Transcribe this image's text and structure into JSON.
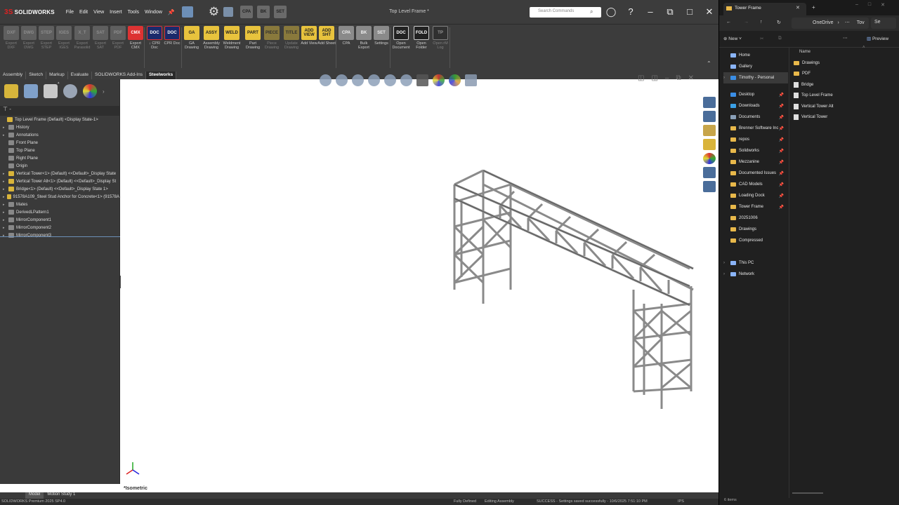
{
  "sw": {
    "app_name": "SOLIDWORKS",
    "menus": [
      "File",
      "Edit",
      "View",
      "Insert",
      "Tools",
      "Window"
    ],
    "doc_title": "Top Level Frame *",
    "search_placeholder": "Search Commands",
    "toolbar_tiles": [
      "CPA",
      "BK",
      "SET"
    ],
    "ribbon": [
      {
        "icon": "DXF",
        "label": "Export DXF",
        "style": "grayi dis"
      },
      {
        "icon": "DWG",
        "label": "Export DWG",
        "style": "grayi dis"
      },
      {
        "icon": "STEP",
        "label": "Export STEP",
        "style": "grayi dis"
      },
      {
        "icon": "IGES",
        "label": "Export IGES",
        "style": "grayi dis"
      },
      {
        "icon": "X_T",
        "label": "Export Parasolid",
        "style": "grayi dis"
      },
      {
        "icon": "SAT",
        "label": "Export SAT",
        "style": "grayi dis"
      },
      {
        "icon": "PDF",
        "label": "Export PDF",
        "style": "grayi dis"
      },
      {
        "icon": "CMX",
        "label": "Export CMX",
        "style": "red"
      },
      {
        "icon": "DOC",
        "label": "↓ CPR Doc",
        "style": "navy"
      },
      {
        "icon": "DOC",
        "label": "CPR Doc",
        "style": "navy"
      },
      {
        "icon": "GA",
        "label": "GA Drawing",
        "style": "yel"
      },
      {
        "icon": "ASSY",
        "label": "Assembly Drawing",
        "style": "yel"
      },
      {
        "icon": "WELD",
        "label": "Weldment Drawing",
        "style": "yel"
      },
      {
        "icon": "PART",
        "label": "Part Drawing",
        "style": "yel"
      },
      {
        "icon": "PIECE",
        "label": "Piece Drawing",
        "style": "yel dis"
      },
      {
        "icon": "TITLE",
        "label": "Update Drawing",
        "style": "yel dis"
      },
      {
        "icon": "ADD VIEW",
        "label": "Add View",
        "style": "yel"
      },
      {
        "icon": "ADD SHT",
        "label": "Add Sheet",
        "style": "yel"
      },
      {
        "icon": "CPA",
        "label": "CPA",
        "style": "grayi"
      },
      {
        "icon": "BK",
        "label": "Bulk Export",
        "style": "grayi"
      },
      {
        "icon": "SET",
        "label": "Settings",
        "style": "grayi"
      },
      {
        "icon": "DOC",
        "label": "Open Document",
        "style": "dark"
      },
      {
        "icon": "FOLD",
        "label": "Open Folder",
        "style": "dark"
      },
      {
        "icon": "TP",
        "label": "Open rM Log",
        "style": "dark dis"
      }
    ],
    "tabs": [
      "Assembly",
      "Sketch",
      "Markup",
      "Evaluate",
      "SOLIDWORKS Add-Ins",
      "Steelworks"
    ],
    "active_tab": "Steelworks",
    "tree": [
      {
        "label": "Top Level Frame (Default) <Display State-1>",
        "expand": "",
        "icon": "yi"
      },
      {
        "label": "History",
        "expand": "▸",
        "icon": ""
      },
      {
        "label": "Annotations",
        "expand": "▸",
        "icon": ""
      },
      {
        "label": "Front Plane",
        "expand": "",
        "icon": ""
      },
      {
        "label": "Top Plane",
        "expand": "",
        "icon": ""
      },
      {
        "label": "Right Plane",
        "expand": "",
        "icon": ""
      },
      {
        "label": "Origin",
        "expand": "",
        "icon": ""
      },
      {
        "label": "Vertical Tower<1> (Default) <<Default>_Display State",
        "expand": "▸",
        "icon": "yi"
      },
      {
        "label": "Vertical Tower Alt<1> (Default) <<Default>_Display St",
        "expand": "▸",
        "icon": "yi"
      },
      {
        "label": "Bridge<1> (Default) <<Default>_Display State 1>",
        "expand": "▸",
        "icon": "yi"
      },
      {
        "label": "91578A109_Steel Stud Anchor for Concrete<1> (91578A",
        "expand": "▸",
        "icon": "yi"
      },
      {
        "label": "Mates",
        "expand": "▸",
        "icon": ""
      },
      {
        "label": "DerivedLPattern1",
        "expand": "▸",
        "icon": ""
      },
      {
        "label": "MirrorComponent1",
        "expand": "▸",
        "icon": ""
      },
      {
        "label": "MirrorComponent2",
        "expand": "▸",
        "icon": ""
      },
      {
        "label": "MirrorComponent3",
        "expand": "▸",
        "icon": ""
      }
    ],
    "view_label": "*Isometric",
    "bottom_tabs": [
      "Model",
      "Motion Study 1"
    ],
    "status": {
      "version": "SOLIDWORKS Premium 2025 SP4.0",
      "defined": "Fully Defined",
      "mode": "Editing Assembly",
      "message": "SUCCESS - Settings saved successfully - 10/6/2025 7:51:10 PM",
      "units": "IPS"
    }
  },
  "explorer": {
    "tab_title": "Tower Frame",
    "address": "OneDrive",
    "address_trail": "Tov",
    "search_short": "Se",
    "new_label": "New",
    "preview_label": "Preview",
    "nav_top": [
      "Home",
      "Gallery",
      "Timothy - Personal"
    ],
    "quick_access": [
      "Desktop",
      "Downloads",
      "Documents",
      "Brenner Software Inc",
      "repos",
      "Solidworks",
      "Mezzanine",
      "Documented Issues",
      "CAD Models",
      "Loading Dock",
      "Tower Frame",
      "20251006",
      "Drawings",
      "Compressed"
    ],
    "nav_bottom": [
      "This PC",
      "Network"
    ],
    "column_name": "Name",
    "files": [
      {
        "name": "Drawings",
        "type": "folder"
      },
      {
        "name": "PDF",
        "type": "folder"
      },
      {
        "name": "Bridge",
        "type": "doc"
      },
      {
        "name": "Top Level Frame",
        "type": "doc"
      },
      {
        "name": "Vertical Tower Alt",
        "type": "doc"
      },
      {
        "name": "Vertical Tower",
        "type": "doc"
      }
    ],
    "item_count": "6 items"
  }
}
